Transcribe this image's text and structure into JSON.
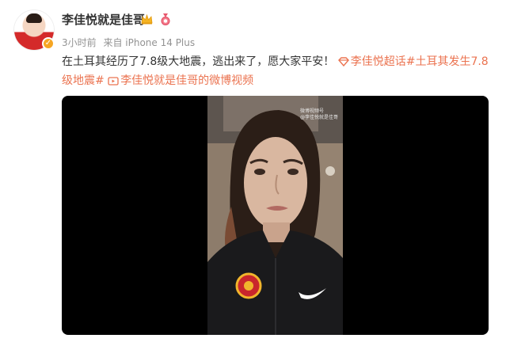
{
  "author": {
    "name": "李佳悦就是佳哥",
    "avatar_icon": "user-avatar-icon",
    "verified_icon": "verified-badge-icon",
    "badges": [
      "crown-badge-icon",
      "medal-badge-icon"
    ]
  },
  "meta": {
    "time": "3小时前",
    "source": "来自 iPhone 14 Plus"
  },
  "post": {
    "text": "在土耳其经历了7.8级大地震，逃出来了，愿大家平安！",
    "supertopic": "李佳悦超话",
    "hashtag": "#土耳其发生7.8级地震#",
    "video_link": "李佳悦就是佳哥的微博视频"
  },
  "video": {
    "watermark_line1": "微博视频号",
    "watermark_line2": "@李佳悦就是佳哥"
  },
  "colors": {
    "link": "#eb7350",
    "meta": "#939393",
    "text": "#333333",
    "video_bg": "#000000"
  }
}
